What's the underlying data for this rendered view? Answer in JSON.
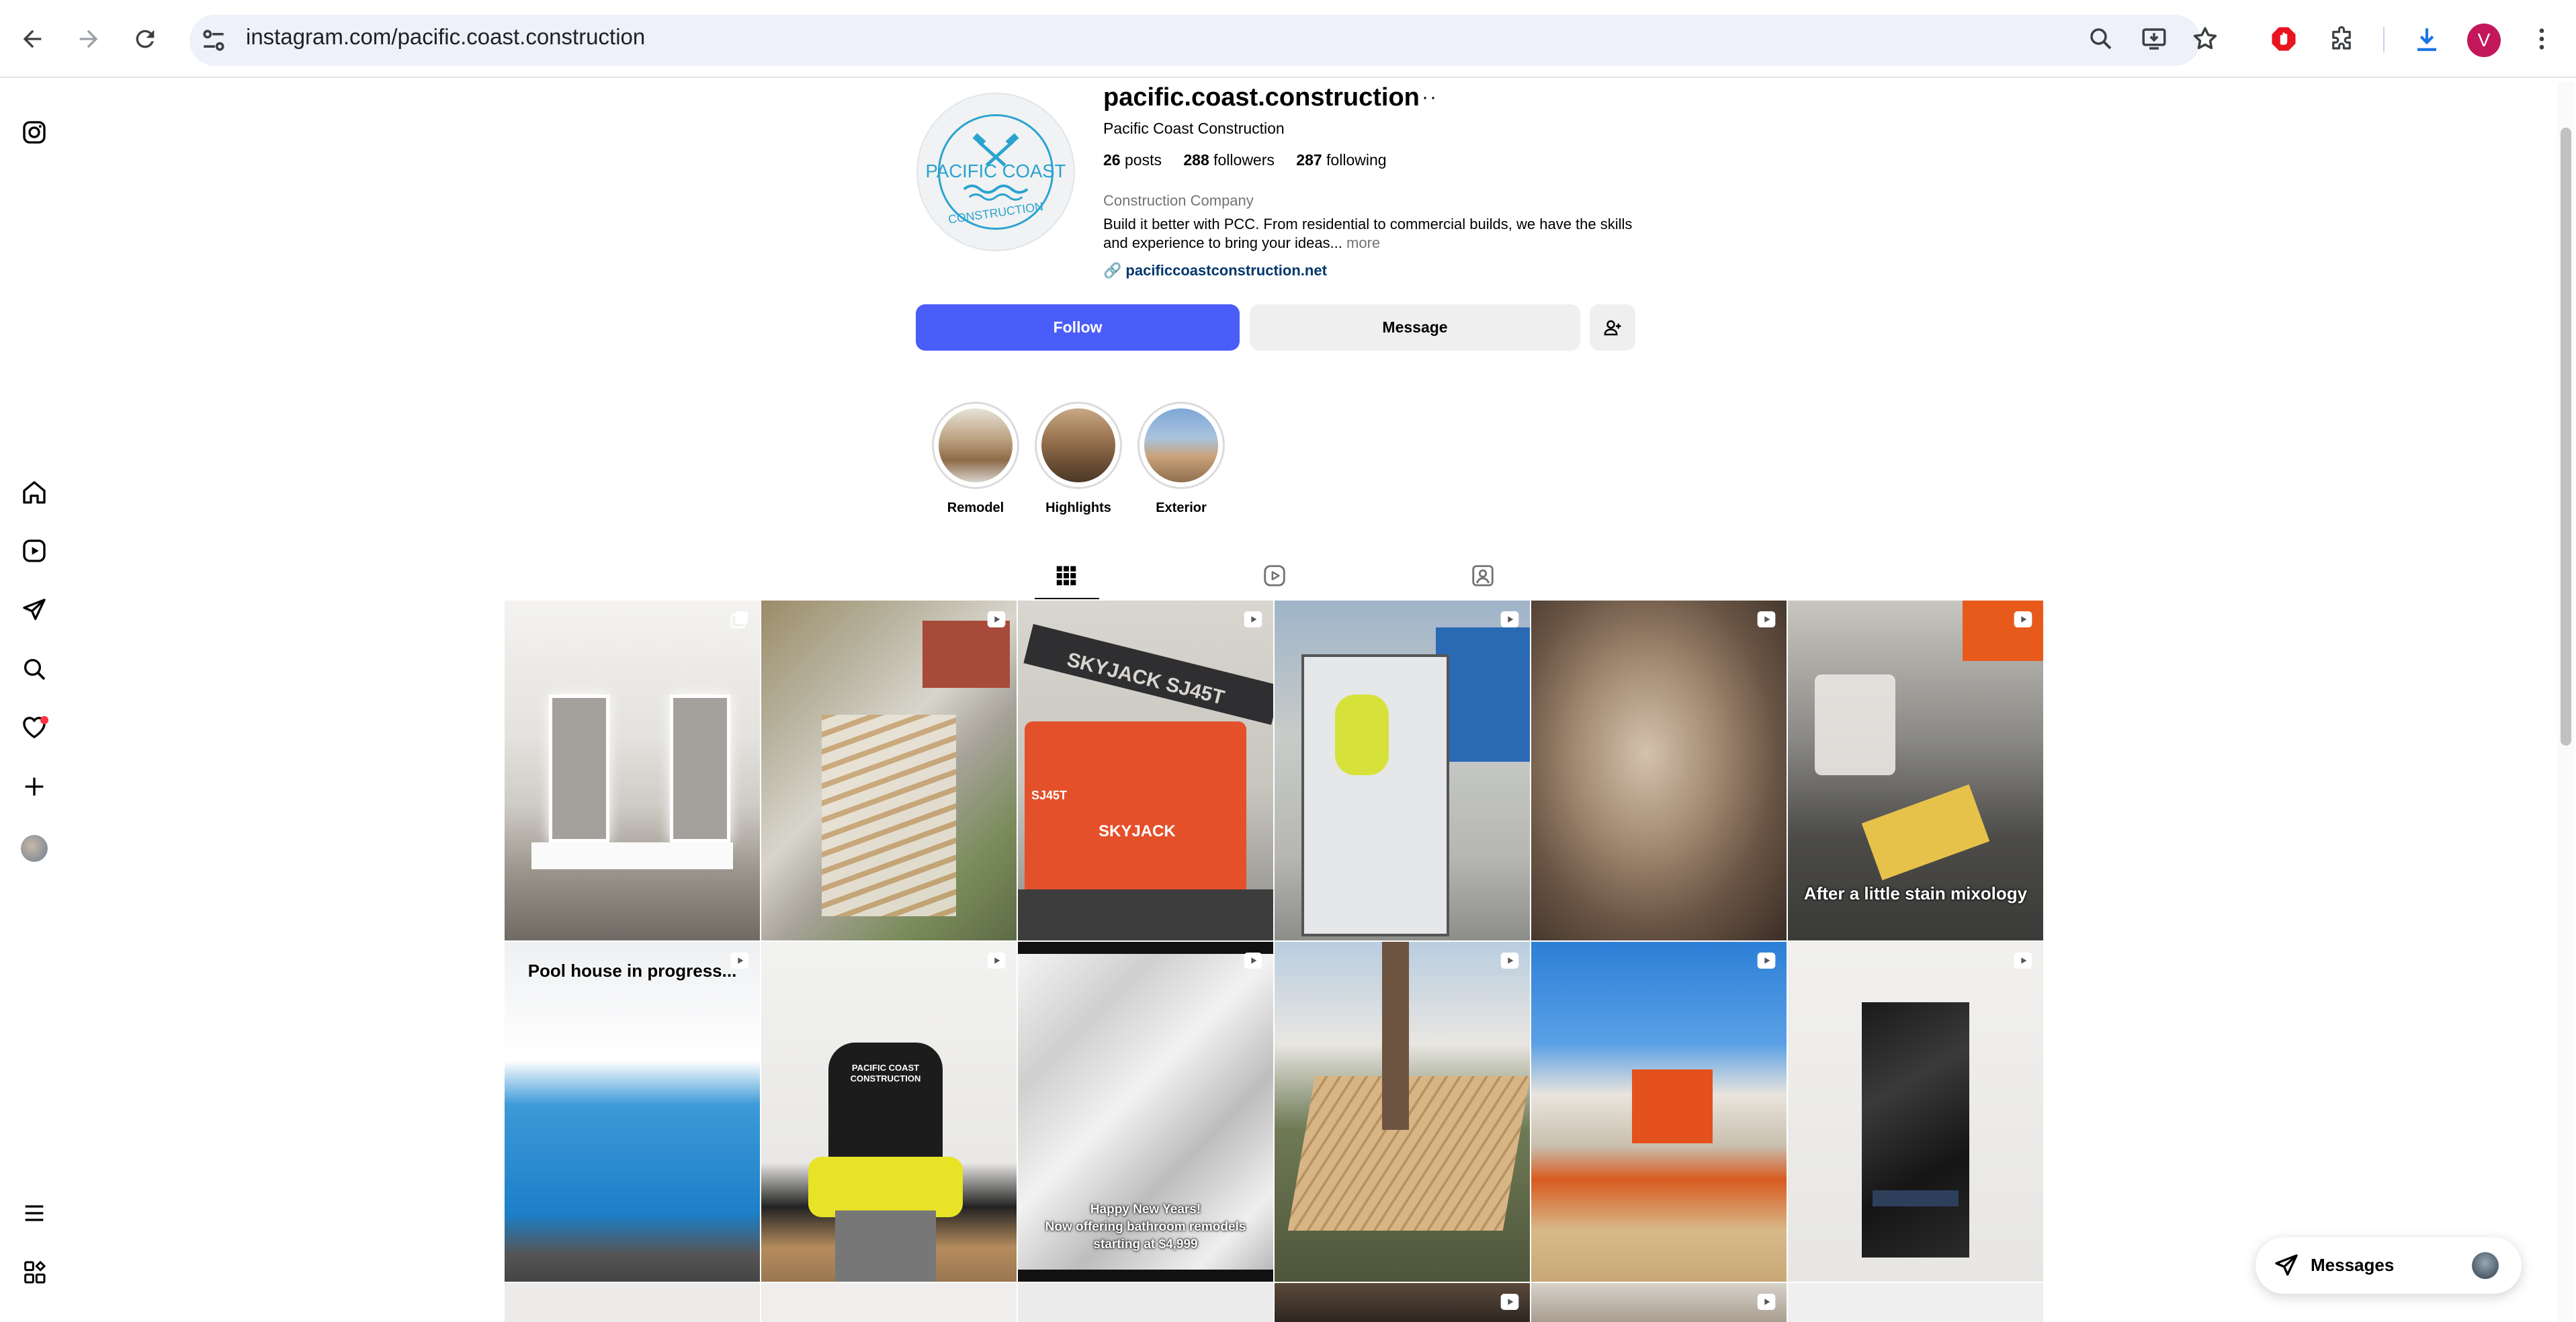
{
  "browser": {
    "url": "instagram.com/pacific.coast.construction",
    "profile_initial": "V",
    "back_icon": "arrow-left-icon",
    "forward_icon": "arrow-right-icon",
    "reload_icon": "reload-icon"
  },
  "sidebar": {
    "items": [
      {
        "name": "instagram-logo-icon"
      },
      {
        "name": "home-icon"
      },
      {
        "name": "reels-icon"
      },
      {
        "name": "messages-icon"
      },
      {
        "name": "search-icon"
      },
      {
        "name": "notifications-icon"
      },
      {
        "name": "create-icon"
      },
      {
        "name": "profile-icon"
      },
      {
        "name": "more-menu-icon"
      },
      {
        "name": "also-from-meta-icon"
      }
    ],
    "notification_color": "#ff3040"
  },
  "profile": {
    "username": "pacific.coast.construction",
    "more": "···",
    "full_name": "Pacific Coast Construction",
    "posts_count": "26",
    "posts_label": "posts",
    "followers_count": "288",
    "followers_label": "followers",
    "following_count": "287",
    "following_label": "following",
    "category": "Construction Company",
    "bio": "Build it better with PCC. From residential to commercial builds, we have the skills and experience to bring your ideas...",
    "bio_more": "more",
    "website": "pacificcoastconstruction.net",
    "logo_line1": "PACIFIC COAST",
    "logo_line2": "CONSTRUCTION",
    "logo_color": "#2aa3cf"
  },
  "actions": {
    "follow": "Follow",
    "message": "Message",
    "follow_color": "#4a5df9"
  },
  "highlights": [
    {
      "label": "Remodel"
    },
    {
      "label": "Highlights"
    },
    {
      "label": "Exterior"
    }
  ],
  "tabs": [
    {
      "name": "posts-grid-icon",
      "active": true
    },
    {
      "name": "reels-tab-icon",
      "active": false
    },
    {
      "name": "tagged-tab-icon",
      "active": false
    }
  ],
  "posts": [
    {
      "type": "carousel",
      "caption": ""
    },
    {
      "type": "reel",
      "caption": ""
    },
    {
      "type": "reel",
      "caption": "",
      "text1": "SKYJACK SJ45T",
      "text2": "SKYJACK",
      "text3": "SJ45T"
    },
    {
      "type": "reel",
      "caption": ""
    },
    {
      "type": "reel",
      "caption": ""
    },
    {
      "type": "reel",
      "caption": "After a little stain mixology"
    },
    {
      "type": "reel",
      "caption": "Pool house in progress..."
    },
    {
      "type": "reel",
      "caption": "",
      "shirt_text": "PACIFIC COAST CONSTRUCTION"
    },
    {
      "type": "reel",
      "caption": "Happy New Years!\nNow offering bathroom remodels\nstarting at $4,999"
    },
    {
      "type": "reel",
      "caption": ""
    },
    {
      "type": "reel",
      "caption": ""
    },
    {
      "type": "reel",
      "caption": ""
    }
  ],
  "messages_pill": {
    "label": "Messages"
  }
}
